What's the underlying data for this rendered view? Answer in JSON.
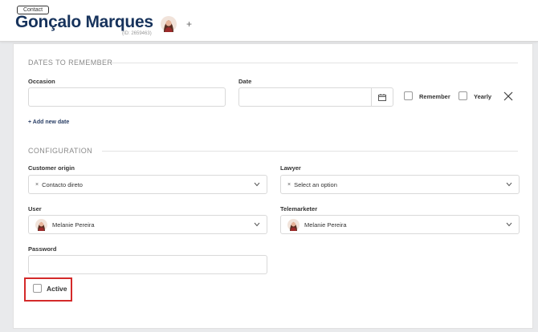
{
  "header": {
    "badge": "Contact",
    "name": "Gonçalo Marques",
    "id_text": "(ID: 2659463)",
    "add_label": "+"
  },
  "dates": {
    "section_title": "DATES TO REMEMBER",
    "occasion_label": "Occasion",
    "date_label": "Date",
    "remember_label": "Remember",
    "yearly_label": "Yearly",
    "add_new_label": "+ Add new date"
  },
  "config": {
    "section_title": "CONFIGURATION",
    "customer_origin": {
      "label": "Customer origin",
      "value": "Contacto direto",
      "clear": "×"
    },
    "lawyer": {
      "label": "Lawyer",
      "value": "Select an option",
      "clear": "×"
    },
    "user": {
      "label": "User",
      "value": "Melanie Pereira"
    },
    "telemarketer": {
      "label": "Telemarketer",
      "value": "Melanie Pereira"
    },
    "password_label": "Password",
    "active_label": "Active"
  },
  "icons": {
    "calendar": "calendar-icon",
    "close": "close-icon",
    "chevron": "chevron-down-icon",
    "avatar": "avatar"
  },
  "colors": {
    "name": "#17335c",
    "highlight": "#d42a2a",
    "link": "#2a3f66"
  }
}
